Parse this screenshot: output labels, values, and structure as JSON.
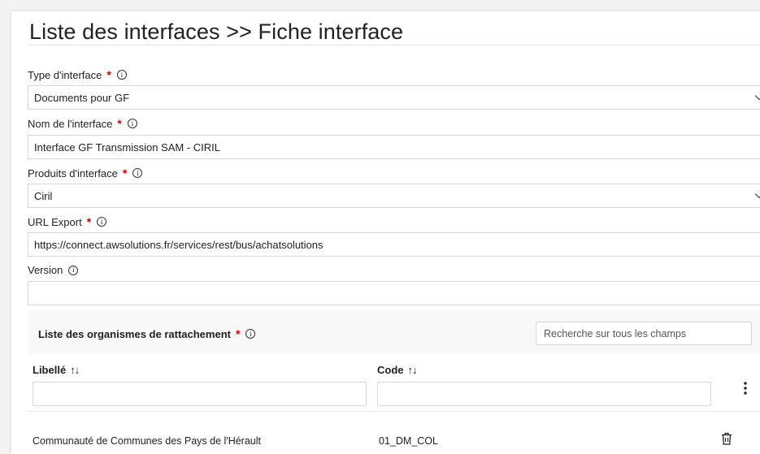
{
  "page": {
    "title": "Liste des interfaces >> Fiche interface"
  },
  "form": {
    "type": {
      "label": "Type d'interface",
      "value": "Documents pour GF"
    },
    "nom": {
      "label": "Nom de l'interface",
      "value": "Interface GF Transmission SAM - CIRIL"
    },
    "produits": {
      "label": "Produits d'interface",
      "value": "Ciril"
    },
    "url": {
      "label": "URL Export",
      "value": "https://connect.awsolutions.fr/services/rest/bus/achatsolutions"
    },
    "version": {
      "label": "Version",
      "value": ""
    },
    "required_mark": "*",
    "info_glyph": "i"
  },
  "organismes": {
    "title": "Liste des organismes de rattachement",
    "search_placeholder": "Recherche sur tous les champs",
    "columns": [
      {
        "label": "Libellé",
        "sort_glyph": "↑↓"
      },
      {
        "label": "Code",
        "sort_glyph": "↑↓"
      }
    ],
    "rows": [
      {
        "libelle": "Communauté de Communes des Pays de l'Hérault",
        "code": "01_DM_COL"
      }
    ]
  },
  "colors": {
    "required": "#d40000",
    "border": "#d6d6d6",
    "header_bg": "#f8f8f8"
  },
  "icons": [
    "info-icon",
    "chevron-down-icon",
    "sort-icon",
    "kebab-menu-icon",
    "trash-icon"
  ]
}
